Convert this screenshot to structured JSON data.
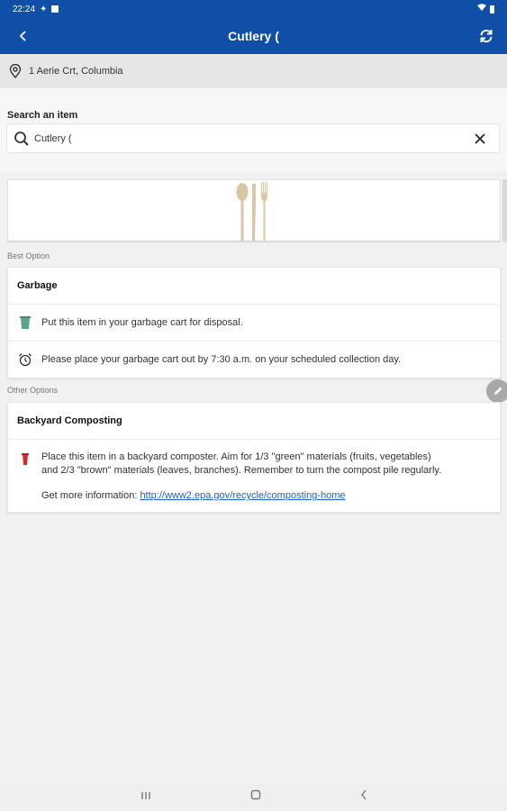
{
  "status_bar": {
    "time": "22:24"
  },
  "header": {
    "title": "Cutlery ("
  },
  "address": {
    "text": "1 Aerie Crt, Columbia"
  },
  "search": {
    "label": "Search an item",
    "value": "Cutlery ("
  },
  "best_option": {
    "section_label": "Best Option",
    "title": "Garbage",
    "rows": [
      {
        "icon": "garbage-cart-icon",
        "text": "Put this item in your garbage cart for disposal."
      },
      {
        "icon": "alarm-clock-icon",
        "text": "Please place your garbage cart out by 7:30 a.m. on your scheduled collection day."
      }
    ]
  },
  "other_options": {
    "section_label": "Other Options",
    "title": "Backyard Composting",
    "line1": "Place this item in a backyard composter. Aim for 1/3 \"green\" materials (fruits, vegetables)",
    "line2": "and 2/3 \"brown\" materials (leaves, branches). Remember to turn the compost pile regularly.",
    "more_info_label": "Get more information: ",
    "link": "http://www2.epa.gov/recycle/composting-home"
  },
  "colors": {
    "app_bar": "#0f4fa8",
    "link": "#1a5ed6",
    "compost_icon": "#d62b2b",
    "garbage_icon": "#5aa58a"
  }
}
